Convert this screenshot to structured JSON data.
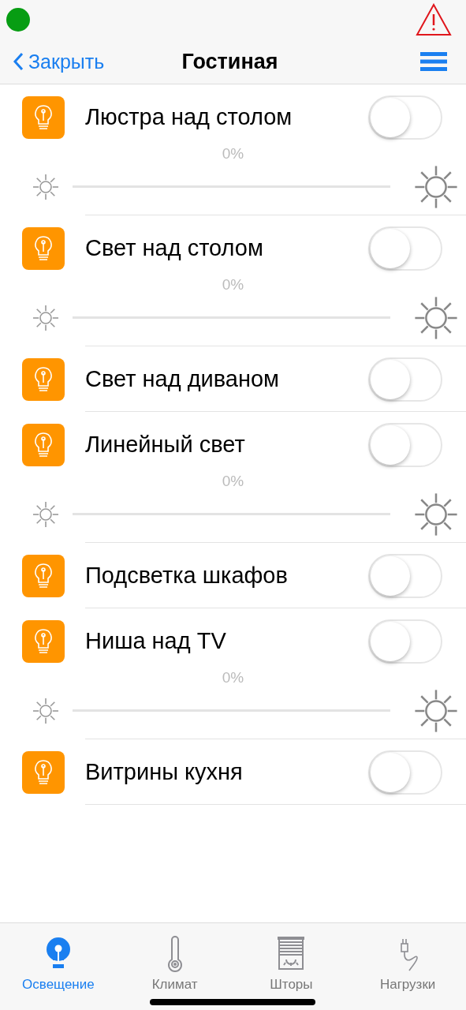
{
  "status": {
    "connected": true,
    "alert": true
  },
  "nav": {
    "back": "Закрыть",
    "title": "Гостиная"
  },
  "lights": [
    {
      "kind": "dimmer",
      "name": "Люстра над столом",
      "on": false,
      "reading": "0%",
      "level": 0
    },
    {
      "kind": "dimmer",
      "name": "Свет над столом",
      "on": false,
      "reading": "0%",
      "level": 0
    },
    {
      "kind": "switch",
      "name": "Свет над диваном",
      "on": false
    },
    {
      "kind": "dimmer",
      "name": "Линейный свет",
      "on": false,
      "reading": "0%",
      "level": 0
    },
    {
      "kind": "switch",
      "name": "Подсветка шкафов",
      "on": false
    },
    {
      "kind": "dimmer",
      "name": "Ниша над TV",
      "on": false,
      "reading": "0%",
      "level": 0
    },
    {
      "kind": "switch",
      "name": "Витрины кухня",
      "on": false
    }
  ],
  "tabs": [
    {
      "kind": "lighting",
      "label": "Освещение",
      "selected": true
    },
    {
      "kind": "climate",
      "label": "Климат",
      "selected": false
    },
    {
      "kind": "blinds",
      "label": "Шторы",
      "selected": false
    },
    {
      "kind": "loads",
      "label": "Нагрузки",
      "selected": false
    }
  ]
}
